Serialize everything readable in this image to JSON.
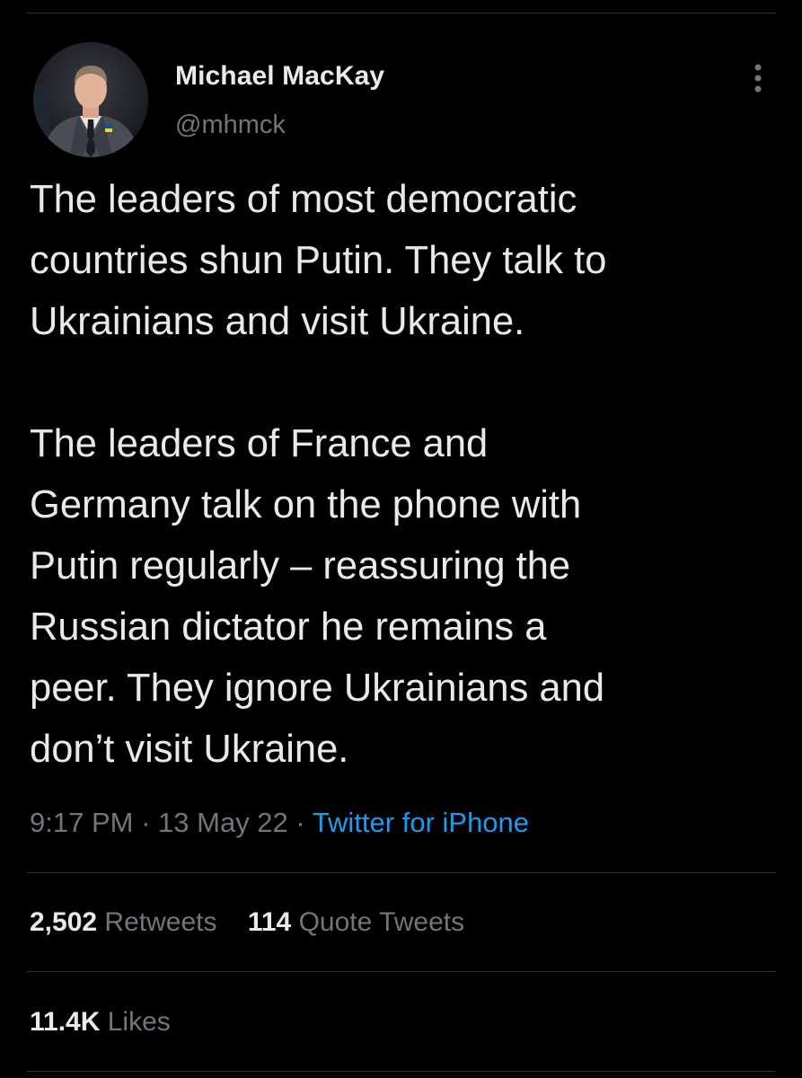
{
  "tweet": {
    "author": {
      "display_name": "Michael MacKay",
      "handle": "@mhmck",
      "avatar_icon": "profile-photo"
    },
    "more_icon": "more-vertical-icon",
    "paragraphs": [
      "The leaders of most democratic\ncountries shun Putin. They talk to\nUkrainians and visit Ukraine.",
      "The leaders of France and\nGermany talk on the phone with\nPutin regularly – reassuring the\nRussian dictator he remains a\npeer. They ignore Ukrainians and\ndon’t visit Ukraine."
    ],
    "time": "9:17 PM",
    "separator": "·",
    "date": "13 May 22",
    "source": "Twitter for iPhone",
    "stats": {
      "retweets_count": "2,502",
      "retweets_label": "Retweets",
      "quotes_count": "114",
      "quotes_label": "Quote Tweets",
      "likes_count": "11.4K",
      "likes_label": "Likes"
    }
  },
  "colors": {
    "background": "#000000",
    "text_primary": "#e7e9ea",
    "text_secondary": "#71767b",
    "link": "#1d9bf0",
    "divider": "#2f3336"
  }
}
